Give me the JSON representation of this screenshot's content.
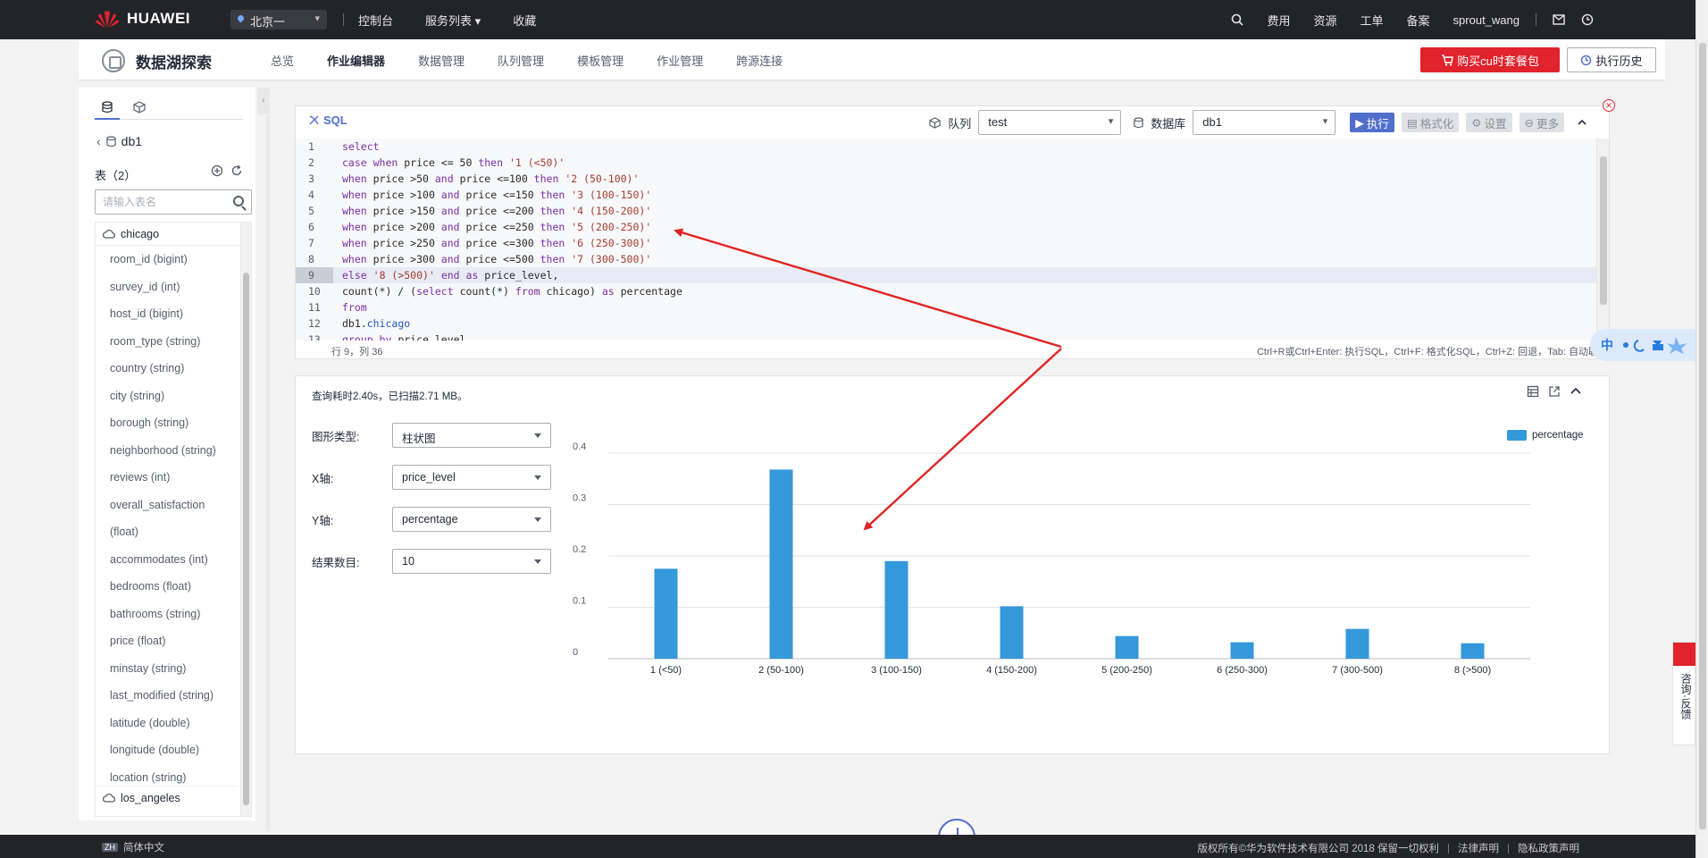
{
  "topbar": {
    "brand": "HUAWEI",
    "region": "北京一",
    "nav": [
      "控制台",
      "服务列表",
      "收藏"
    ],
    "services_caret": "▾",
    "right": [
      "费用",
      "资源",
      "工单",
      "备案",
      "sprout_wang"
    ]
  },
  "subhead": {
    "title": "数据湖探索",
    "tabs": [
      "总览",
      "作业编辑器",
      "数据管理",
      "队列管理",
      "模板管理",
      "作业管理",
      "跨源连接"
    ],
    "active_tab": "作业编辑器",
    "buy_button": "购买cu时套餐包",
    "history_button": "执行历史"
  },
  "sidebar": {
    "database": "db1",
    "tables_label": "表（2）",
    "search_placeholder": "请输入表名",
    "table1": "chicago",
    "columns": [
      "room_id (bigint)",
      "survey_id (int)",
      "host_id (bigint)",
      "room_type (string)",
      "country (string)",
      "city (string)",
      "borough (string)",
      "neighborhood (string)",
      "reviews (int)",
      "overall_satisfaction",
      "(float)",
      "accommodates (int)",
      "bedrooms (float)",
      "bathrooms (string)",
      "price (float)",
      "minstay (string)",
      "last_modified (string)",
      "latitude (double)",
      "longitude (double)",
      "location (string)"
    ],
    "table2": "los_angeles"
  },
  "editor": {
    "label": "SQL",
    "queue_label": "队列",
    "queue_value": "test",
    "db_label": "数据库",
    "db_value": "db1",
    "run": "执行",
    "format": "格式化",
    "settings": "设置",
    "more": "更多",
    "cursor": "行 9，列 36",
    "shortcuts": "Ctrl+R或Ctrl+Enter: 执行SQL，Ctrl+F: 格式化SQL，Ctrl+Z: 回退，Tab: 自动联",
    "active_line": 9,
    "lines": [
      "select",
      "case when price <= 50 then '1 (<50)'",
      "when price >50 and price <=100 then '2 (50-100)'",
      "when price >100 and price <=150 then '3 (100-150)'",
      "when price >150 and price <=200 then '4 (150-200)'",
      "when price >200 and price <=250 then '5 (200-250)'",
      "when price >250 and price <=300 then '6 (250-300)'",
      "when price >300 and price <=500 then '7 (300-500)'",
      "else '8 (>500)' end as price_level,",
      "count(*) / (select count(*) from chicago) as percentage",
      "from",
      "db1.chicago",
      "group by price_level"
    ]
  },
  "lang_widget": "中",
  "result": {
    "query_info": "查询耗时2.40s，已扫描2.71 MB。",
    "chart_type_label": "图形类型:",
    "chart_type_value": "柱状图",
    "x_label": "X轴:",
    "x_value": "price_level",
    "y_label": "Y轴:",
    "y_value": "percentage",
    "count_label": "结果数目:",
    "count_value": "10"
  },
  "chart_data": {
    "type": "bar",
    "categories": [
      "1 (<50)",
      "2 (50-100)",
      "3 (100-150)",
      "4 (150-200)",
      "5 (200-250)",
      "6 (250-300)",
      "7 (300-500)",
      "8 (>500)"
    ],
    "series": [
      {
        "name": "percentage",
        "values": [
          0.175,
          0.368,
          0.19,
          0.102,
          0.044,
          0.032,
          0.058,
          0.03
        ]
      }
    ],
    "yticks": [
      "0",
      "0.1",
      "0.2",
      "0.3",
      "0.4"
    ],
    "ylim": [
      0,
      0.4
    ],
    "grid": true,
    "legend": "top-right",
    "color": "#3498db"
  },
  "feedback": "咨询·反馈",
  "footer": {
    "lang": "简体中文",
    "lang_badge": "ZH",
    "copyright": "版权所有©华为软件技术有限公司 2018 保留一切权利",
    "legal": "法律声明",
    "privacy": "隐私政策声明"
  },
  "colors": {
    "accent": "#526ecc",
    "brand_red": "#e0232c",
    "bar": "#3498db",
    "annotation": "#e02424"
  }
}
